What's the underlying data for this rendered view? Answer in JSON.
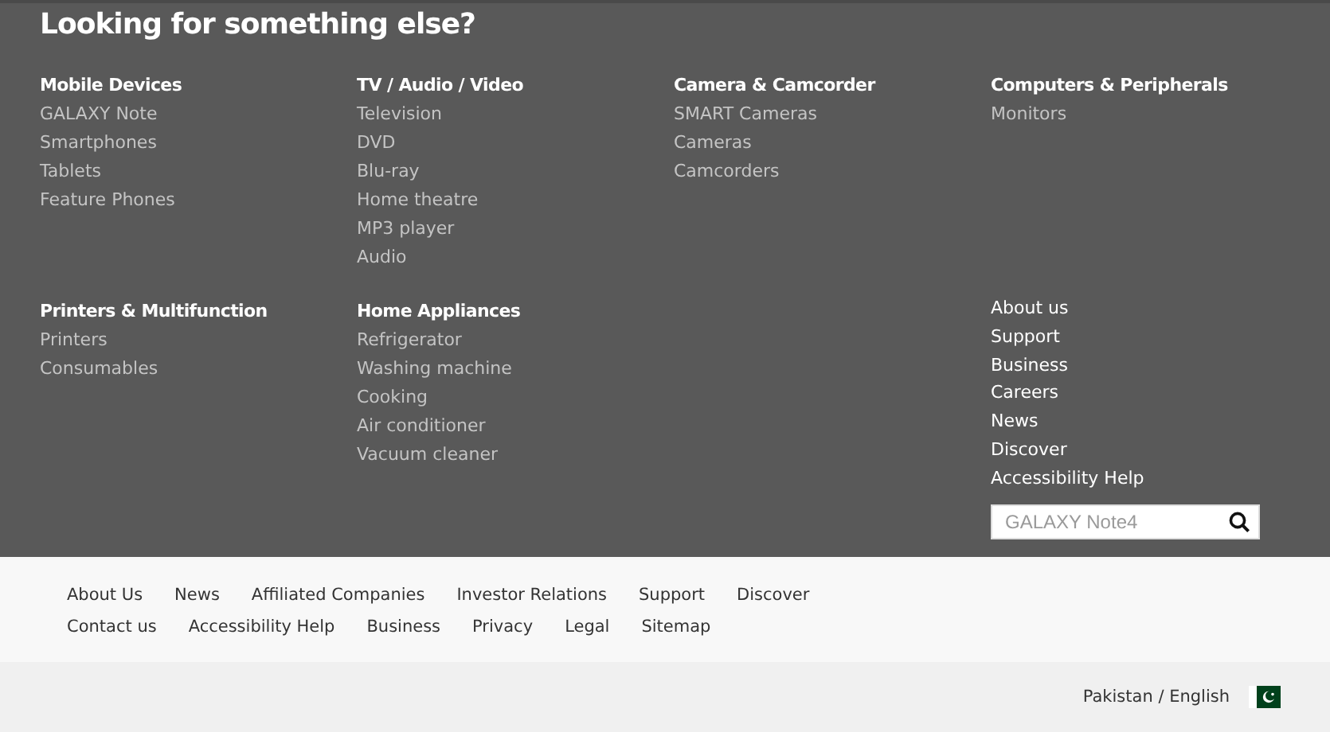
{
  "heading": "Looking for something else?",
  "categories": [
    {
      "title": "Mobile Devices",
      "links": [
        "GALAXY Note",
        "Smartphones",
        "Tablets",
        "Feature Phones"
      ]
    },
    {
      "title": "TV / Audio / Video",
      "links": [
        "Television",
        "DVD",
        "Blu-ray",
        "Home theatre",
        "MP3 player",
        "Audio"
      ]
    },
    {
      "title": "Camera & Camcorder",
      "links": [
        "SMART Cameras",
        "Cameras",
        "Camcorders"
      ]
    },
    {
      "title": "Computers & Peripherals",
      "links": [
        "Monitors"
      ]
    },
    {
      "title": "Printers & Multifunction",
      "links": [
        "Printers",
        "Consumables"
      ]
    },
    {
      "title": "Home Appliances",
      "links": [
        "Refrigerator",
        "Washing machine",
        "Cooking",
        "Air conditioner",
        "Vacuum cleaner"
      ]
    }
  ],
  "company_links": [
    "About us",
    "Support",
    "Business",
    "Careers",
    "News",
    "Discover",
    "Accessibility Help"
  ],
  "search": {
    "placeholder": "GALAXY Note4"
  },
  "footer_links": [
    [
      "About Us",
      "News",
      "Affiliated Companies",
      "Investor Relations",
      "Support",
      "Discover"
    ],
    [
      "Contact us",
      "Accessibility Help",
      "Business",
      "Privacy",
      "Legal",
      "Sitemap"
    ]
  ],
  "locale": "Pakistan / English"
}
